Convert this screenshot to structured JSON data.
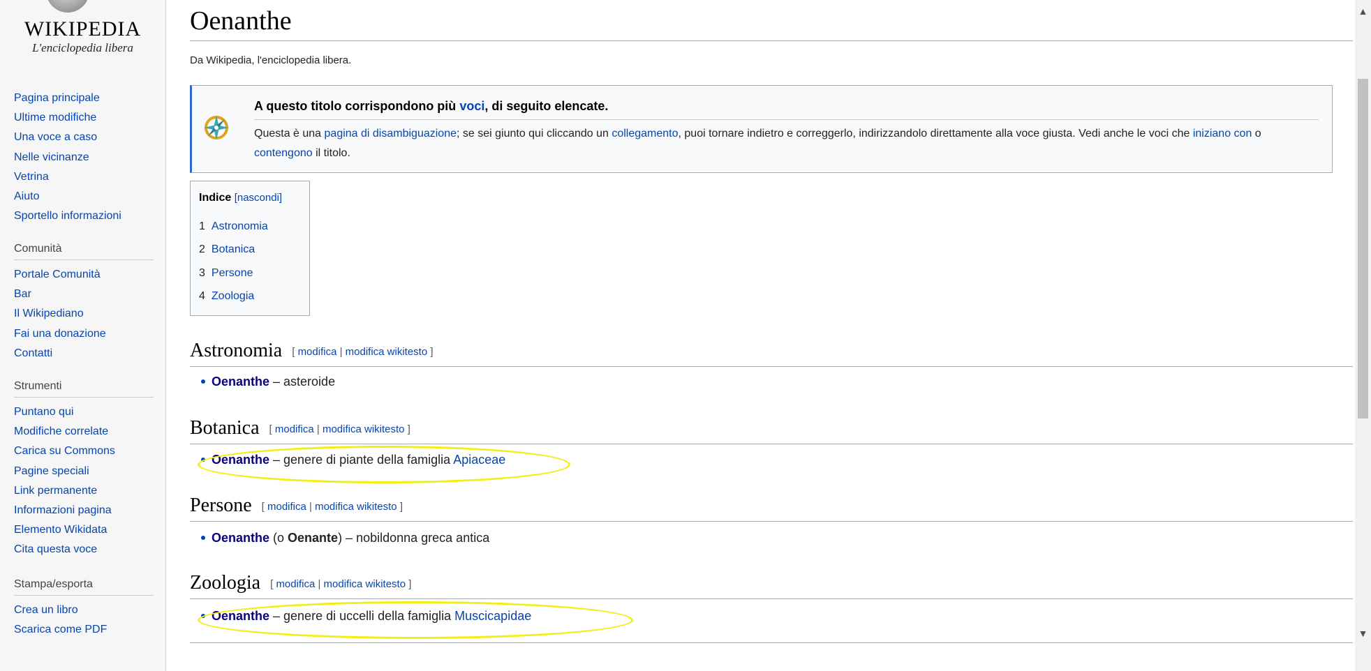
{
  "sidebar": {
    "logo": {
      "wordmark": "WIKIPEDIA",
      "tagline": "L'enciclopedia libera"
    },
    "navigation": [
      "Pagina principale",
      "Ultime modifiche",
      "Una voce a caso",
      "Nelle vicinanze",
      "Vetrina",
      "Aiuto",
      "Sportello informazioni"
    ],
    "community": {
      "title": "Comunità",
      "items": [
        "Portale Comunità",
        "Bar",
        "Il Wikipediano",
        "Fai una donazione",
        "Contatti"
      ]
    },
    "tools": {
      "title": "Strumenti",
      "items": [
        "Puntano qui",
        "Modifiche correlate",
        "Carica su Commons",
        "Pagine speciali",
        "Link permanente",
        "Informazioni pagina",
        "Elemento Wikidata",
        "Cita questa voce"
      ]
    },
    "print": {
      "title": "Stampa/esporta",
      "items": [
        "Crea un libro",
        "Scarica come PDF"
      ]
    }
  },
  "page": {
    "title": "Oenanthe",
    "site_sub": "Da Wikipedia, l'enciclopedia libera."
  },
  "disambig": {
    "title_pre": "A questo titolo corrispondono più ",
    "title_link": "voci",
    "title_post": ", di seguito elencate.",
    "t1": "Questa è una ",
    "l1": "pagina di disambiguazione",
    "t2": "; se sei giunto qui cliccando un ",
    "l2": "collegamento",
    "t3": ", puoi tornare indietro e correggerlo, indirizzandolo direttamente alla voce giusta. Vedi anche le voci che ",
    "l3": "iniziano con",
    "t4": " o ",
    "l4": "contengono",
    "t5": " il titolo."
  },
  "toc": {
    "title": "Indice",
    "bracket_open": "[",
    "toggle": "nascondi",
    "bracket_close": "]",
    "items": [
      {
        "number": "1",
        "label": "Astronomia"
      },
      {
        "number": "2",
        "label": "Botanica"
      },
      {
        "number": "3",
        "label": "Persone"
      },
      {
        "number": "4",
        "label": "Zoologia"
      }
    ]
  },
  "edit_labels": {
    "open": "[",
    "edit": "modifica",
    "sep": " | ",
    "edit_source": "modifica wikitesto",
    "close": "]"
  },
  "sections": [
    {
      "heading": "Astronomia",
      "term": "Oenanthe",
      "text": " – asteroide"
    },
    {
      "heading": "Botanica",
      "term": "Oenanthe",
      "text": " – genere di piante della famiglia ",
      "link": "Apiaceae"
    },
    {
      "heading": "Persone",
      "term": "Oenanthe",
      "text_a": " (o ",
      "term2": "Oenante",
      "text_b": ") – nobildonna greca antica"
    },
    {
      "heading": "Zoologia",
      "term": "Oenanthe",
      "text": " – genere di uccelli della famiglia ",
      "link": "Muscicapidae"
    }
  ],
  "colors": {
    "link": "#0645ad",
    "visited_link": "#0b0080",
    "highlight": "#f3ee16",
    "sidebar_bg": "#f6f6f6"
  }
}
